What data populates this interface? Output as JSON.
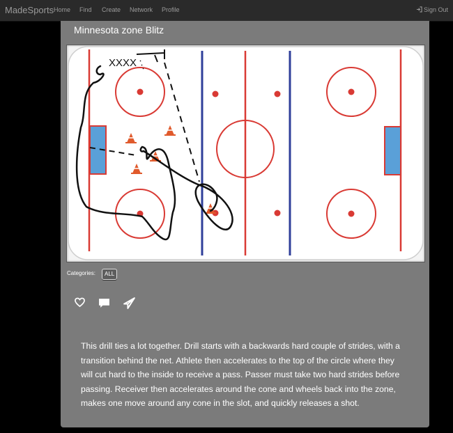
{
  "nav": {
    "brand": "MadeSports",
    "links": [
      "Home",
      "Find",
      "Create",
      "Network",
      "Profile"
    ],
    "signout": "Sign Out"
  },
  "drill": {
    "title": "Minnesota zone Blitz",
    "diagram_text": "XXXX",
    "categories_label": "Categories:",
    "category": "ALL",
    "actions": [
      "heart-icon",
      "comment-icon",
      "send-icon"
    ],
    "description": "This drill ties a lot together. Drill starts with a backwards hard couple of strides, with a transition behind the net. Athlete then accelerates to the top of the circle where they will cut hard to the inside to receive a pass. Passer must take two hard strides before passing. Receiver then accelerates around the cone and wheels back into the zone, makes one move around any cone in the slot, and quickly releases a shot."
  },
  "colors": {
    "rink_red": "#d93a34",
    "rink_blue": "#2f3f9a",
    "goal_fill": "#5aa0d8",
    "cone": "#e05a2c"
  }
}
